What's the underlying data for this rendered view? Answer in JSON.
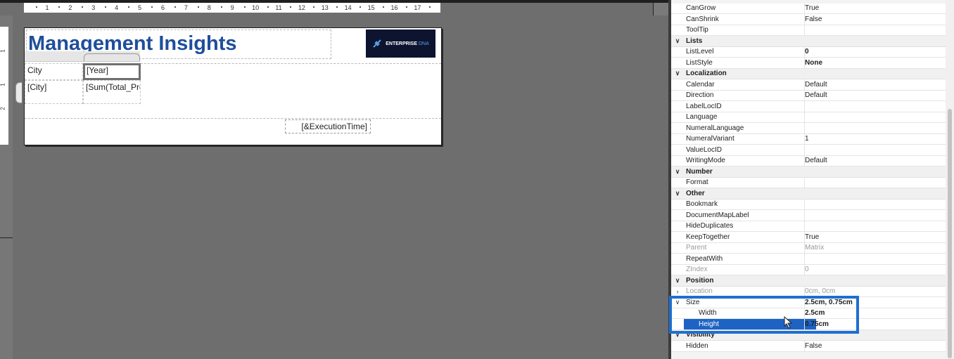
{
  "designer": {
    "ruler_numbers": [
      "1",
      "2",
      "3",
      "4",
      "5",
      "6",
      "7",
      "8",
      "9",
      "10",
      "11",
      "12",
      "13",
      "14",
      "15",
      "16",
      "17"
    ],
    "ruler_vertical": [
      "1",
      "1",
      "2"
    ],
    "report": {
      "title": "Management Insights",
      "logo_brand": "ENTERPRISE",
      "logo_sub": "DNA",
      "cells": {
        "city_header": "City",
        "year_header": "[Year]",
        "city_field": "[City]",
        "sum_field": "[Sum(Total_Pro"
      },
      "footer_field": "[&ExecutionTime]"
    }
  },
  "properties": [
    {
      "type": "prop",
      "name": "CanGrow",
      "value": "True"
    },
    {
      "type": "prop",
      "name": "CanShrink",
      "value": "False"
    },
    {
      "type": "prop",
      "name": "ToolTip",
      "value": ""
    },
    {
      "type": "cat",
      "name": "Lists"
    },
    {
      "type": "prop",
      "name": "ListLevel",
      "value": "0",
      "bold": true
    },
    {
      "type": "prop",
      "name": "ListStyle",
      "value": "None",
      "bold": true
    },
    {
      "type": "cat",
      "name": "Localization"
    },
    {
      "type": "prop",
      "name": "Calendar",
      "value": "Default"
    },
    {
      "type": "prop",
      "name": "Direction",
      "value": "Default"
    },
    {
      "type": "prop",
      "name": "LabelLocID",
      "value": ""
    },
    {
      "type": "prop",
      "name": "Language",
      "value": ""
    },
    {
      "type": "prop",
      "name": "NumeralLanguage",
      "value": ""
    },
    {
      "type": "prop",
      "name": "NumeralVariant",
      "value": "1"
    },
    {
      "type": "prop",
      "name": "ValueLocID",
      "value": ""
    },
    {
      "type": "prop",
      "name": "WritingMode",
      "value": "Default"
    },
    {
      "type": "cat",
      "name": "Number"
    },
    {
      "type": "prop",
      "name": "Format",
      "value": ""
    },
    {
      "type": "cat",
      "name": "Other"
    },
    {
      "type": "prop",
      "name": "Bookmark",
      "value": ""
    },
    {
      "type": "prop",
      "name": "DocumentMapLabel",
      "value": ""
    },
    {
      "type": "prop",
      "name": "HideDuplicates",
      "value": ""
    },
    {
      "type": "prop",
      "name": "KeepTogether",
      "value": "True"
    },
    {
      "type": "prop",
      "name": "Parent",
      "value": "Matrix",
      "muted": true
    },
    {
      "type": "prop",
      "name": "RepeatWith",
      "value": ""
    },
    {
      "type": "prop",
      "name": "ZIndex",
      "value": "0",
      "muted": true
    },
    {
      "type": "cat",
      "name": "Position"
    },
    {
      "type": "prop",
      "name": "Location",
      "value": "0cm, 0cm",
      "muted": true,
      "expander": "collapsed"
    },
    {
      "type": "prop",
      "name": "Size",
      "value": "2.5cm, 0.75cm",
      "bold": true,
      "expander": "expanded"
    },
    {
      "type": "sub",
      "name": "Width",
      "value": "2.5cm",
      "bold": true
    },
    {
      "type": "sub",
      "name": "Height",
      "value": "0.75cm",
      "bold": true,
      "selected": true
    },
    {
      "type": "cat",
      "name": "Visibility"
    },
    {
      "type": "prop",
      "name": "Hidden",
      "value": "False"
    }
  ],
  "colors": {
    "accent": "#1e6fd1",
    "title": "#1f4e9c",
    "selection": "#1e63c4"
  }
}
